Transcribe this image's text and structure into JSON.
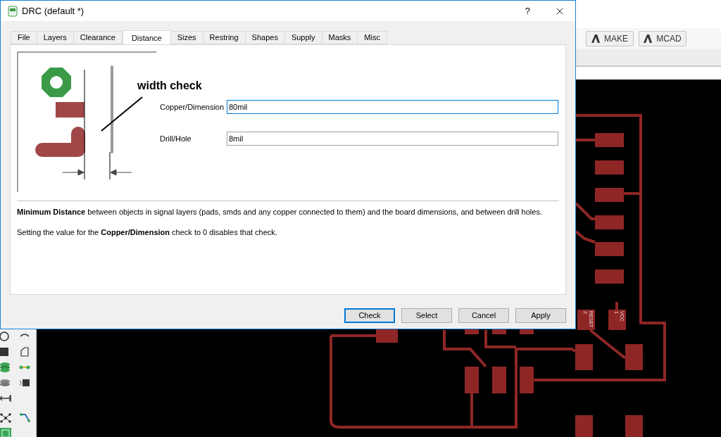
{
  "main_window": {
    "toolbar_buttons": [
      {
        "label": "MAKE"
      },
      {
        "label": "MCAD"
      }
    ]
  },
  "board": {
    "pad_labels": [
      {
        "number": "2",
        "name": "RESET"
      },
      {
        "number": "1",
        "name": "VCC"
      }
    ]
  },
  "dialog": {
    "title": "DRC (default *)",
    "help": "?",
    "tabs": [
      {
        "label": "File",
        "selected": false
      },
      {
        "label": "Layers",
        "selected": false
      },
      {
        "label": "Clearance",
        "selected": false
      },
      {
        "label": "Distance",
        "selected": true
      },
      {
        "label": "Sizes",
        "selected": false
      },
      {
        "label": "Restring",
        "selected": false
      },
      {
        "label": "Shapes",
        "selected": false
      },
      {
        "label": "Supply",
        "selected": false
      },
      {
        "label": "Masks",
        "selected": false
      },
      {
        "label": "Misc",
        "selected": false
      }
    ],
    "annotation": "width check",
    "fields": [
      {
        "label": "Copper/Dimension",
        "value": "80mil",
        "focused": true
      },
      {
        "label": "Drill/Hole",
        "value": "8mil",
        "focused": false
      }
    ],
    "description": [
      "**Minimum Distance** between objects in signal layers (pads, smds and any copper connected to them) and the board dimensions, and between drill holes.",
      "Setting the value for the **Copper/Dimension** check to 0 disables that check."
    ],
    "buttons": [
      {
        "label": "Check",
        "default": true
      },
      {
        "label": "Select",
        "default": false
      },
      {
        "label": "Cancel",
        "default": false
      },
      {
        "label": "Apply",
        "default": false
      }
    ]
  }
}
